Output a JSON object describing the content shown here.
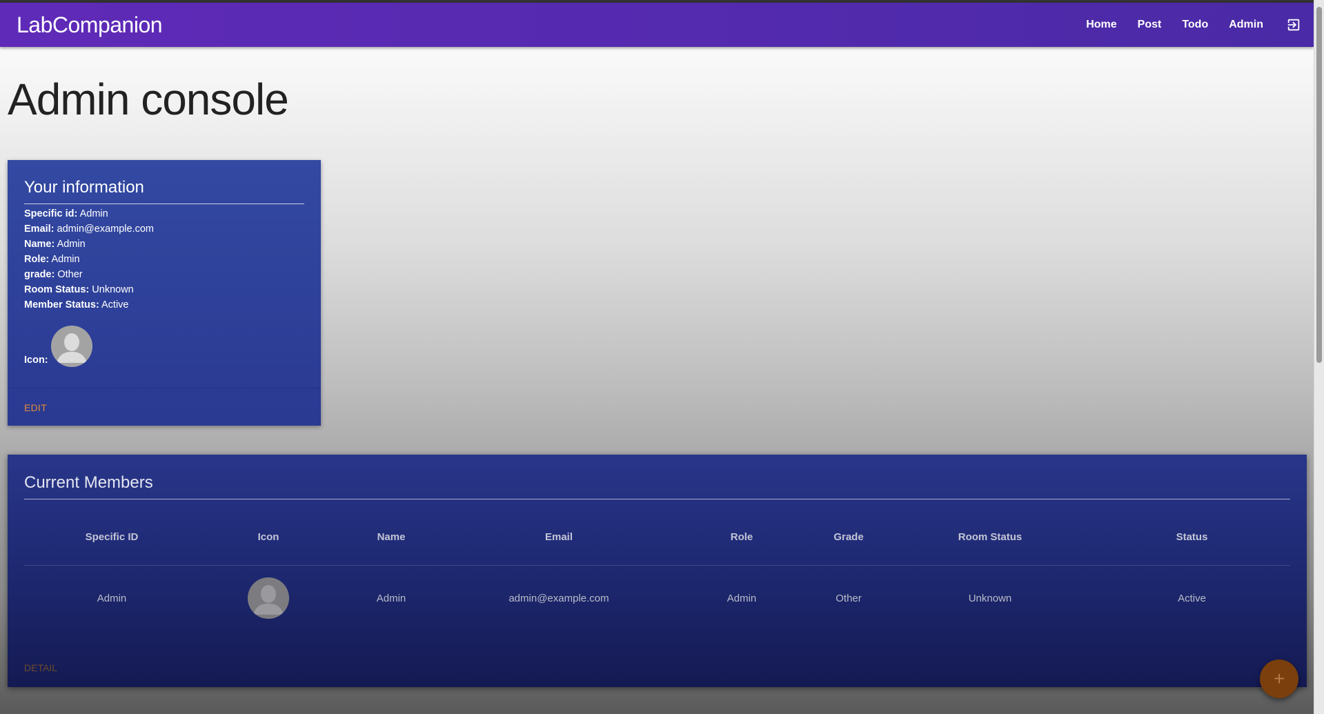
{
  "navbar": {
    "brand": "LabCompanion",
    "links": [
      "Home",
      "Post",
      "Todo",
      "Admin"
    ],
    "logout_icon": "logout-icon"
  },
  "page": {
    "title": "Admin console"
  },
  "your_info": {
    "title": "Your information",
    "rows": [
      {
        "label": "Specific id:",
        "value": "Admin"
      },
      {
        "label": "Email:",
        "value": "admin@example.com"
      },
      {
        "label": "Name:",
        "value": "Admin"
      },
      {
        "label": "Role:",
        "value": "Admin"
      },
      {
        "label": "grade:",
        "value": "Other"
      },
      {
        "label": "Room Status:",
        "value": "Unknown"
      },
      {
        "label": "Member Status:",
        "value": "Active"
      }
    ],
    "icon_label": "Icon:",
    "edit_label": "EDIT"
  },
  "members": {
    "title": "Current Members",
    "columns": [
      "Specific ID",
      "Icon",
      "Name",
      "Email",
      "Role",
      "Grade",
      "Room Status",
      "Status"
    ],
    "rows": [
      {
        "specific_id": "Admin",
        "name": "Admin",
        "email": "admin@example.com",
        "role": "Admin",
        "grade": "Other",
        "room_status": "Unknown",
        "status": "Active"
      }
    ],
    "detail_label": "DETAIL"
  },
  "fab": {
    "label": "+"
  },
  "colors": {
    "navbar": "#5b2ab6",
    "card": "#3349a2",
    "accent": "#e08b3a"
  }
}
